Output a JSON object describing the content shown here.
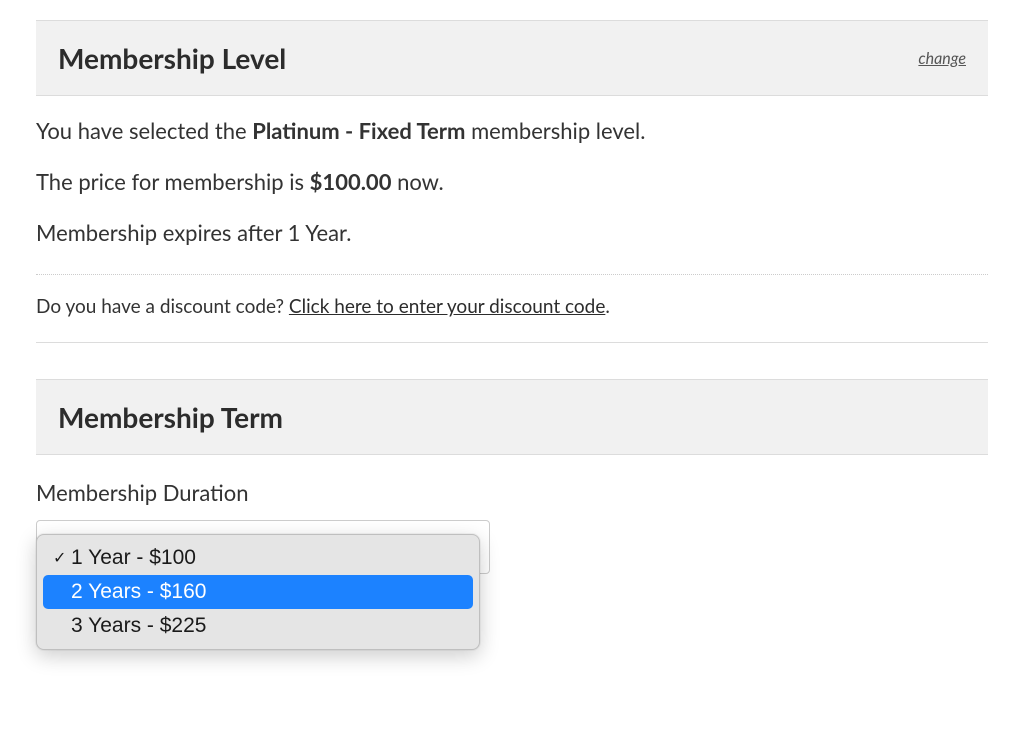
{
  "level": {
    "heading": "Membership Level",
    "change_label": "change",
    "selected_prefix": "You have selected the ",
    "selected_level": "Platinum - Fixed Term",
    "selected_suffix": " membership level.",
    "price_prefix": "The price for membership is ",
    "price": "$100.00",
    "price_suffix": " now.",
    "expiry": "Membership expires after 1 Year.",
    "discount_prompt": "Do you have a discount code? ",
    "discount_link": "Click here to enter your discount code",
    "discount_period": "."
  },
  "term": {
    "heading": "Membership Term",
    "duration_label": "Membership Duration",
    "options": [
      {
        "label": "1 Year - $100",
        "selected": true,
        "highlighted": false
      },
      {
        "label": "2 Years - $160",
        "selected": false,
        "highlighted": true
      },
      {
        "label": "3 Years - $225",
        "selected": false,
        "highlighted": false
      }
    ]
  }
}
